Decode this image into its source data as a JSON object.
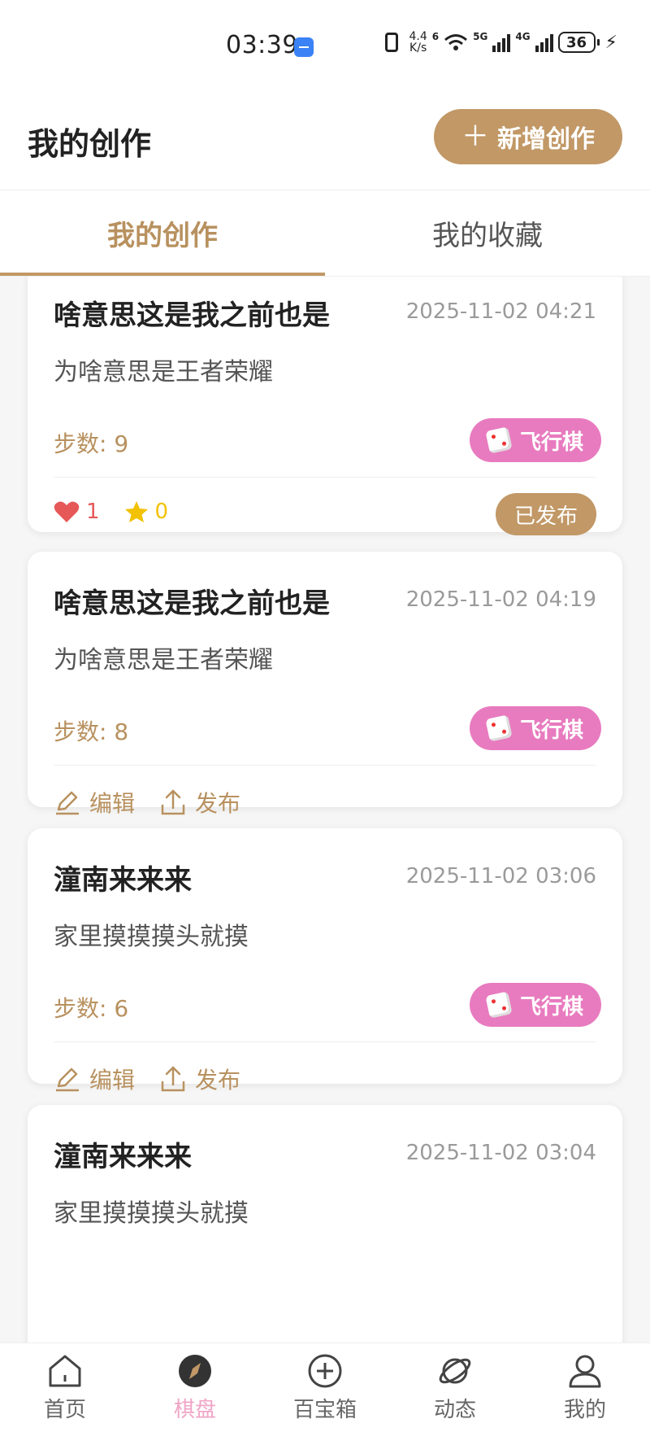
{
  "status_bar": {
    "time": "03:39",
    "net_speed_value": "4.4",
    "net_speed_unit": "K/s",
    "wifi_label": "6",
    "sig1_label": "5G",
    "sig2_label": "4G",
    "battery": "36"
  },
  "header": {
    "title": "我的创作",
    "new_button_label": "新增创作"
  },
  "tabs": [
    {
      "label": "我的创作",
      "active": true
    },
    {
      "label": "我的收藏",
      "active": false
    }
  ],
  "cards": [
    {
      "title": "啥意思这是我之前也是",
      "date": "2025-11-02 04:21",
      "desc": "为啥意思是王者荣耀",
      "steps": "步数: 9",
      "game": "飞行棋",
      "published": true,
      "likes": "1",
      "favorites": "0",
      "status": "已发布"
    },
    {
      "title": "啥意思这是我之前也是",
      "date": "2025-11-02 04:19",
      "desc": "为啥意思是王者荣耀",
      "steps": "步数: 8",
      "game": "飞行棋",
      "published": false,
      "edit_label": "编辑",
      "publish_label": "发布"
    },
    {
      "title": "潼南来来来",
      "date": "2025-11-02 03:06",
      "desc": "家里摸摸摸头就摸",
      "steps": "步数: 6",
      "game": "飞行棋",
      "published": false,
      "edit_label": "编辑",
      "publish_label": "发布"
    },
    {
      "title": "潼南来来来",
      "date": "2025-11-02 03:04",
      "desc": "家里摸摸摸头就摸"
    }
  ],
  "bottom_nav": [
    {
      "label": "首页",
      "icon": "home-icon",
      "active": false
    },
    {
      "label": "棋盘",
      "icon": "compass-icon",
      "active": true
    },
    {
      "label": "百宝箱",
      "icon": "plus-circle-icon",
      "active": false
    },
    {
      "label": "动态",
      "icon": "planet-icon",
      "active": false
    },
    {
      "label": "我的",
      "icon": "user-icon",
      "active": false
    }
  ],
  "colors": {
    "accent": "#c19866",
    "tag_pink": "#e87bbf",
    "like_red": "#e65858",
    "star_yellow": "#f2c200",
    "nav_active": "#f0a5c6"
  }
}
